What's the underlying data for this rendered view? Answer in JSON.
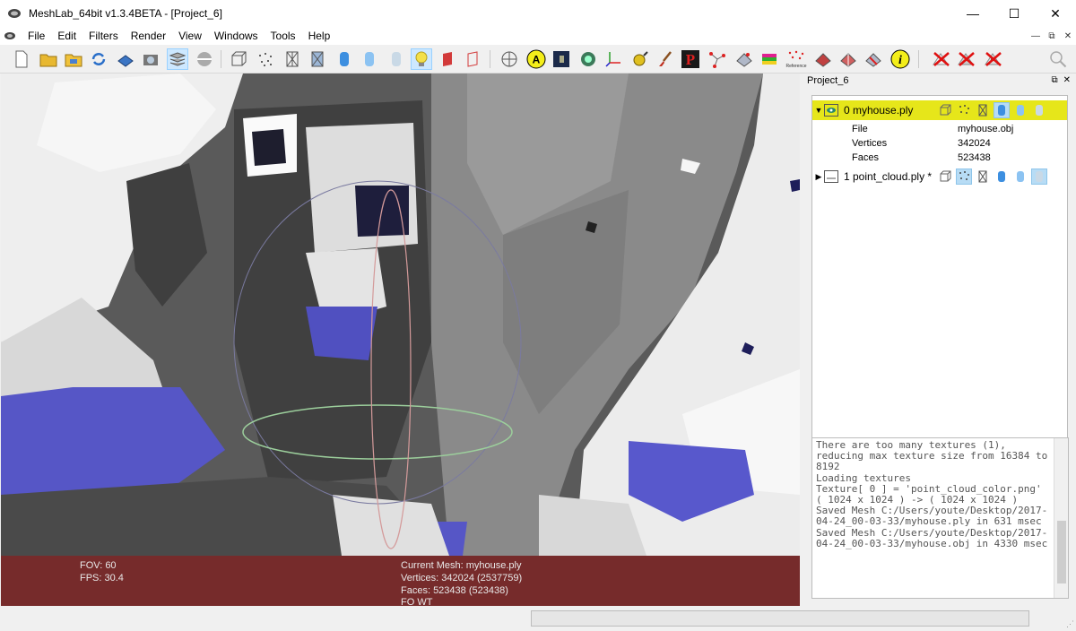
{
  "window": {
    "title": "MeshLab_64bit v1.3.4BETA - [Project_6]",
    "minimize": "—",
    "maximize": "☐",
    "close": "✕"
  },
  "menu": {
    "items": [
      "File",
      "Edit",
      "Filters",
      "Render",
      "View",
      "Windows",
      "Tools",
      "Help"
    ],
    "mdi_minimize": "—",
    "mdi_restore": "⧉",
    "mdi_close": "✕"
  },
  "toolbar": {
    "icons": [
      "new-icon",
      "open-icon",
      "open-project-icon",
      "reload-icon",
      "save-icon",
      "snapshot-icon",
      "layers-icon",
      "raster-icon",
      "bounding-box-icon",
      "points-icon",
      "wireframe-icon",
      "hidden-lines-icon",
      "flat-shading-icon",
      "smooth-shading-icon",
      "texture-icon",
      "lighting-icon",
      "backface-icon",
      "double-side-icon",
      "trackball-icon",
      "text-annotation-icon",
      "render-icon",
      "globe-icon",
      "axis-icon",
      "measure-icon",
      "paint-icon",
      "pickpoint-icon",
      "align-icon",
      "transform-icon",
      "color-icon",
      "reference-icon",
      "edit-mesh-icon",
      "select-icon",
      "info-icon",
      "delete-vertices-icon",
      "delete-faces-icon",
      "delete-both-icon",
      "search-icon"
    ],
    "info_symbol": "i",
    "text_symbol": "A",
    "p_symbol": "P",
    "reference_text": "Reference"
  },
  "viewport": {
    "overlay": {
      "fov": "FOV: 60",
      "fps": "FPS:   30.4",
      "current_mesh": "Current Mesh: myhouse.ply",
      "vertices": "Vertices: 342024 (2537759)",
      "faces": "Faces: 523438 (523438)",
      "extra": "FO WT"
    }
  },
  "panel": {
    "title": "Project_6",
    "float_btn": "⧉",
    "close_btn": "✕",
    "layers": [
      {
        "label": "0  myhouse.ply",
        "selected": true,
        "properties": [
          {
            "key": "File",
            "value": "myhouse.obj"
          },
          {
            "key": "Vertices",
            "value": "342024"
          },
          {
            "key": "Faces",
            "value": "523438"
          }
        ]
      },
      {
        "label": "1  point_cloud.ply *",
        "selected": false,
        "properties": []
      }
    ],
    "log": "There are too many textures (1), reducing max texture size from 16384 to 8192\nLoading textures\nTexture[ 0 ] = 'point_cloud_color.png' ( 1024 x 1024 ) -> ( 1024 x 1024 )\nSaved Mesh C:/Users/youte/Desktop/2017-04-24_00-03-33/myhouse.ply in 631 msec\nSaved Mesh C:/Users/youte/Desktop/2017-04-24_00-03-33/myhouse.obj in 4330 msec"
  },
  "colors": {
    "selected_layer": "#e6e61a",
    "overlay": "#801818",
    "mesh_white": "#f2f2f2",
    "mesh_dark": "#555555",
    "mesh_blue": "#5454c8"
  }
}
